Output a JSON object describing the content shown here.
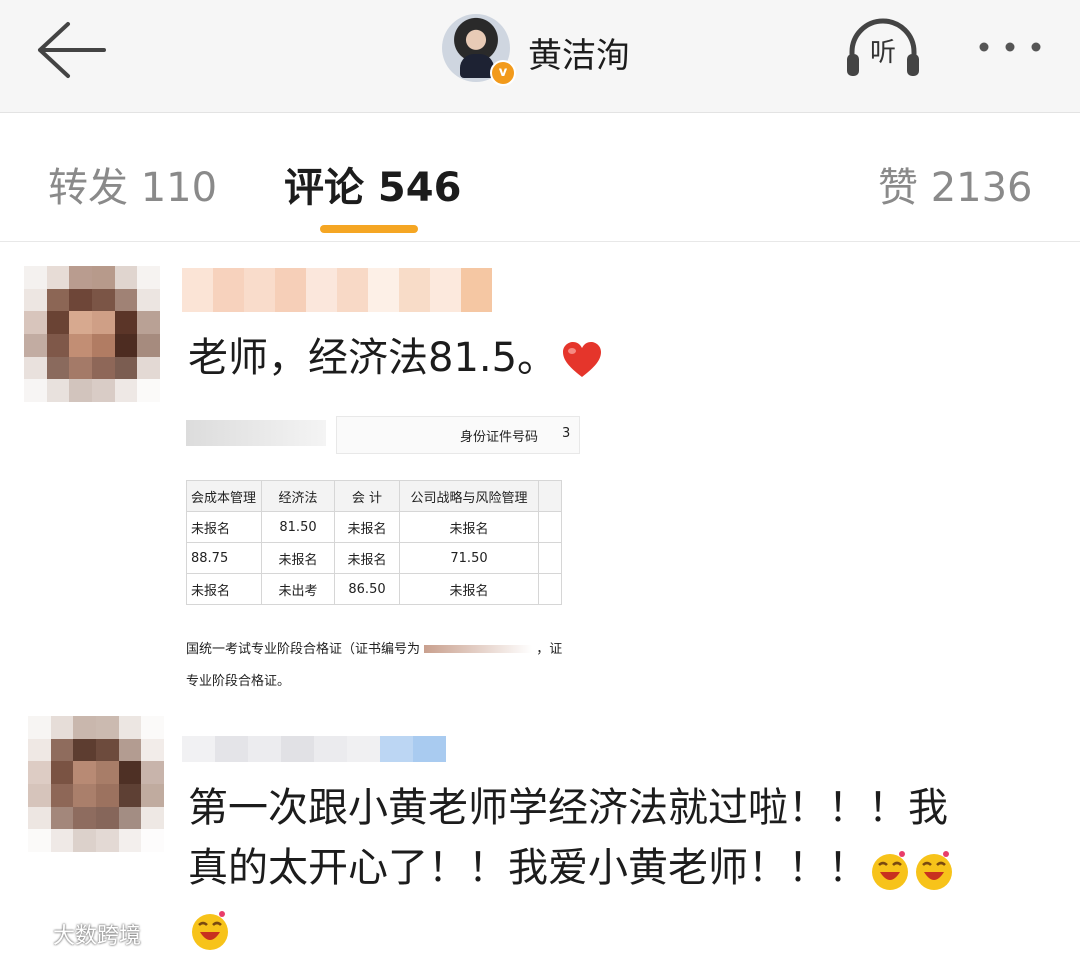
{
  "header": {
    "title": "黄洁洵",
    "listen_label": "听",
    "verified_mark": "v"
  },
  "tabs": [
    {
      "label": "转发 110",
      "active": false
    },
    {
      "label": "评论 546",
      "active": true
    },
    {
      "label": "赞 2136",
      "active": false
    }
  ],
  "accent_color": "#f5a623",
  "comments": [
    {
      "text": "老师，经济法81.5。",
      "emoji": "heart-icon",
      "attachment": {
        "id_label": "身份证件号码",
        "id_value_partial": "3",
        "table": {
          "headers": [
            "会成本管理",
            "经济法",
            "会 计",
            "公司战略与风险管理"
          ],
          "rows": [
            [
              "未报名",
              "81.50",
              "未报名",
              "未报名"
            ],
            [
              "88.75",
              "未报名",
              "未报名",
              "71.50"
            ],
            [
              "未报名",
              "未出考",
              "86.50",
              "未报名"
            ]
          ]
        },
        "cert_line1": "国统一考试专业阶段合格证（证书编号为",
        "cert_line1_end": "，证",
        "cert_line2": "专业阶段合格证。"
      }
    },
    {
      "text_line1": "第一次跟小黄老师学经济法就过啦！！！我",
      "text_line2": "真的太开心了！！我爱小黄老师！！！",
      "emoji": "laughing-face-icon"
    }
  ],
  "watermark": "大数跨境"
}
